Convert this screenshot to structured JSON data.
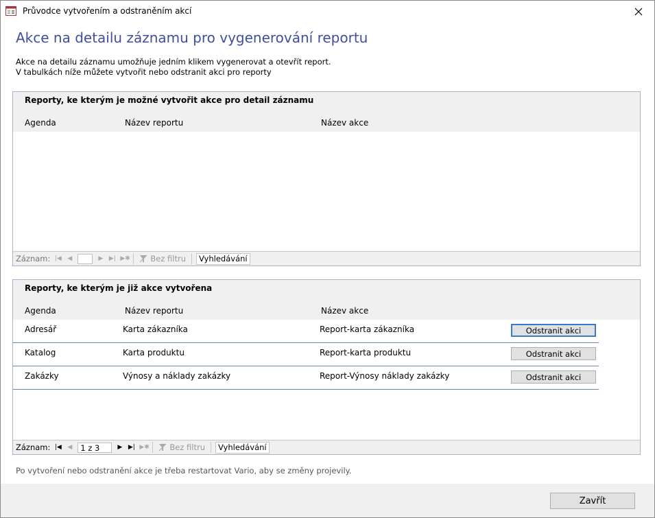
{
  "window": {
    "title": "Průvodce vytvořením a odstraněním akcí"
  },
  "page": {
    "heading": "Akce na detailu záznamu pro vygenerování reportu",
    "description_line1": "Akce na detailu záznamu umožňuje jedním klikem vygenerovat a otevřít report.",
    "description_line2": "V tabulkách níže můžete vytvořit nebo odstranit akci pro reporty",
    "footnote": "Po vytvoření nebo odstranění akce je třeba restartovat Vario, aby se změny projevily."
  },
  "panel_available": {
    "title": "Reporty, ke kterým je možné vytvořit akce pro detail záznamu",
    "columns": [
      "Agenda",
      "Název reportu",
      "Název akce"
    ],
    "navigation": {
      "label": "Záznam:",
      "position": "",
      "filter": "Bez filtru",
      "search": "Vyhledávání"
    }
  },
  "panel_created": {
    "title": "Reporty, ke kterým je již akce vytvořena",
    "columns": [
      "Agenda",
      "Název reportu",
      "Název akce"
    ],
    "rows": [
      {
        "agenda": "Adresář",
        "report": "Karta zákazníka",
        "action": "Report-karta zákazníka",
        "button": "Odstranit akci"
      },
      {
        "agenda": "Katalog",
        "report": "Karta produktu",
        "action": "Report-karta produktu",
        "button": "Odstranit akci"
      },
      {
        "agenda": "Zakázky",
        "report": "Výnosy a náklady zakázky",
        "action": "Report-Výnosy náklady zakázky",
        "button": "Odstranit akci"
      }
    ],
    "navigation": {
      "label": "Záznam:",
      "position": "1 z 3",
      "filter": "Bez filtru",
      "search": "Vyhledávání"
    }
  },
  "footer": {
    "close_label": "Zavřít"
  },
  "colors": {
    "heading": "#3f4fa0",
    "panel_border": "#a8b4c8",
    "row_divider": "#6a86b0"
  }
}
